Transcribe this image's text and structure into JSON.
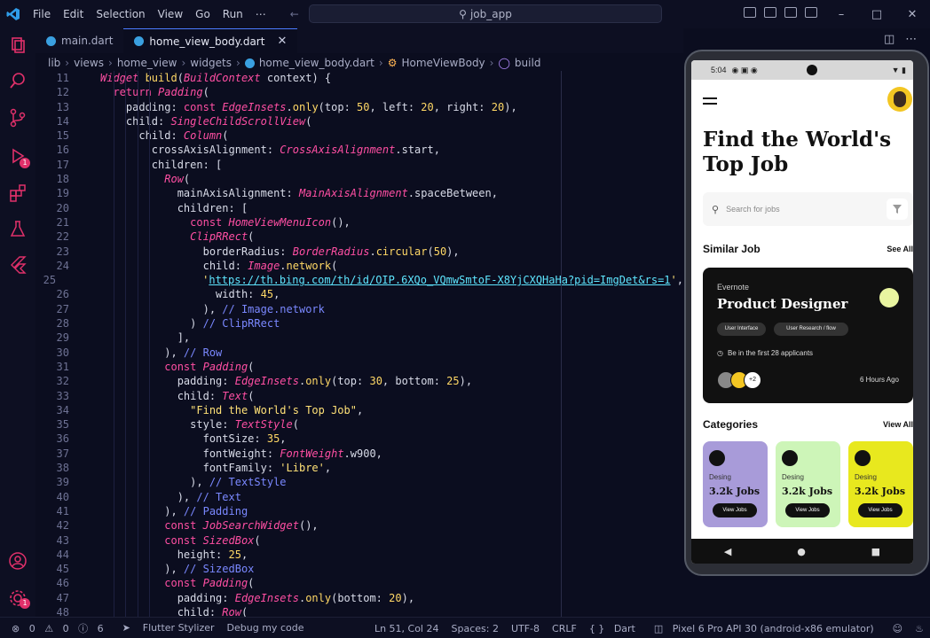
{
  "titlebar": {
    "menu": [
      "File",
      "Edit",
      "Selection",
      "View",
      "Go",
      "Run",
      "⋯"
    ],
    "search": "job_app"
  },
  "tabs": [
    {
      "label": "main.dart"
    },
    {
      "label": "home_view_body.dart"
    }
  ],
  "breadcrumb": [
    "lib",
    "views",
    "home_view",
    "widgets",
    "home_view_body.dart",
    "HomeViewBody",
    "build"
  ],
  "code_lines": [
    {
      "n": "11",
      "t": [
        [
          "ty",
          "Widget "
        ],
        [
          "fn",
          "build"
        ],
        [
          "pr",
          "("
        ],
        [
          "ty",
          "BuildContext"
        ],
        [
          "pr",
          " context) {"
        ]
      ]
    },
    {
      "n": "12",
      "t": [
        [
          "kw",
          "  return "
        ],
        [
          "ty",
          "Padding"
        ],
        [
          "pr",
          "("
        ]
      ]
    },
    {
      "n": "13",
      "t": [
        [
          "pr",
          "    padding: "
        ],
        [
          "kw",
          "const "
        ],
        [
          "ty",
          "EdgeInsets"
        ],
        [
          "pr",
          "."
        ],
        [
          "fn",
          "only"
        ],
        [
          "pr",
          "(top: "
        ],
        [
          "num",
          "50"
        ],
        [
          "pr",
          ", left: "
        ],
        [
          "num",
          "20"
        ],
        [
          "pr",
          ", right: "
        ],
        [
          "num",
          "20"
        ],
        [
          "pr",
          "),"
        ]
      ]
    },
    {
      "n": "14",
      "t": [
        [
          "pr",
          "    child: "
        ],
        [
          "ty",
          "SingleChildScrollView"
        ],
        [
          "pr",
          "("
        ]
      ]
    },
    {
      "n": "15",
      "t": [
        [
          "pr",
          "      child: "
        ],
        [
          "ty",
          "Column"
        ],
        [
          "pr",
          "("
        ]
      ]
    },
    {
      "n": "16",
      "t": [
        [
          "pr",
          "        crossAxisAlignment: "
        ],
        [
          "ty",
          "CrossAxisAlignment"
        ],
        [
          "pr",
          ".start,"
        ]
      ]
    },
    {
      "n": "17",
      "t": [
        [
          "pr",
          "        children: ["
        ]
      ]
    },
    {
      "n": "18",
      "t": [
        [
          "ty",
          "          Row"
        ],
        [
          "pr",
          "("
        ]
      ]
    },
    {
      "n": "19",
      "t": [
        [
          "pr",
          "            mainAxisAlignment: "
        ],
        [
          "ty",
          "MainAxisAlignment"
        ],
        [
          "pr",
          ".spaceBetween,"
        ]
      ]
    },
    {
      "n": "20",
      "t": [
        [
          "pr",
          "            children: ["
        ]
      ]
    },
    {
      "n": "21",
      "t": [
        [
          "kw",
          "              const "
        ],
        [
          "ty",
          "HomeViewMenuIcon"
        ],
        [
          "pr",
          "(),"
        ]
      ]
    },
    {
      "n": "22",
      "t": [
        [
          "ty",
          "              ClipRRect"
        ],
        [
          "pr",
          "("
        ]
      ]
    },
    {
      "n": "23",
      "t": [
        [
          "pr",
          "                borderRadius: "
        ],
        [
          "ty",
          "BorderRadius"
        ],
        [
          "pr",
          "."
        ],
        [
          "fn",
          "circular"
        ],
        [
          "pr",
          "("
        ],
        [
          "num",
          "50"
        ],
        [
          "pr",
          "),"
        ]
      ]
    },
    {
      "n": "24",
      "t": [
        [
          "pr",
          "                child: "
        ],
        [
          "ty",
          "Image"
        ],
        [
          "pr",
          "."
        ],
        [
          "fn",
          "network"
        ],
        [
          "pr",
          "("
        ]
      ]
    },
    {
      "n": "25",
      "t": [
        [
          "str",
          "                  '"
        ],
        [
          "link",
          "https://th.bing.com/th/id/OIP.6XQo_VQmwSmtoF-X8YjCXQHaHa?pid=ImgDet&rs=1"
        ],
        [
          "str",
          "'"
        ],
        [
          "pr",
          ","
        ]
      ]
    },
    {
      "n": "26",
      "t": [
        [
          "pr",
          "                  width: "
        ],
        [
          "num",
          "45"
        ],
        [
          "pr",
          ","
        ]
      ]
    },
    {
      "n": "27",
      "t": [
        [
          "pr",
          "                ), "
        ],
        [
          "cm",
          "// Image.network"
        ]
      ]
    },
    {
      "n": "28",
      "t": [
        [
          "pr",
          "              ) "
        ],
        [
          "cm",
          "// ClipRRect"
        ]
      ]
    },
    {
      "n": "29",
      "t": [
        [
          "pr",
          "            ],"
        ]
      ]
    },
    {
      "n": "30",
      "t": [
        [
          "pr",
          "          ), "
        ],
        [
          "cm",
          "// Row"
        ]
      ]
    },
    {
      "n": "31",
      "t": [
        [
          "kw",
          "          const "
        ],
        [
          "ty",
          "Padding"
        ],
        [
          "pr",
          "("
        ]
      ]
    },
    {
      "n": "32",
      "t": [
        [
          "pr",
          "            padding: "
        ],
        [
          "ty",
          "EdgeInsets"
        ],
        [
          "pr",
          "."
        ],
        [
          "fn",
          "only"
        ],
        [
          "pr",
          "(top: "
        ],
        [
          "num",
          "30"
        ],
        [
          "pr",
          ", bottom: "
        ],
        [
          "num",
          "25"
        ],
        [
          "pr",
          "),"
        ]
      ]
    },
    {
      "n": "33",
      "t": [
        [
          "pr",
          "            child: "
        ],
        [
          "ty",
          "Text"
        ],
        [
          "pr",
          "("
        ]
      ]
    },
    {
      "n": "34",
      "t": [
        [
          "str",
          "              \"Find the World's Top Job\""
        ],
        [
          "pr",
          ","
        ]
      ]
    },
    {
      "n": "35",
      "t": [
        [
          "pr",
          "              style: "
        ],
        [
          "ty",
          "TextStyle"
        ],
        [
          "pr",
          "("
        ]
      ]
    },
    {
      "n": "36",
      "t": [
        [
          "pr",
          "                fontSize: "
        ],
        [
          "num",
          "35"
        ],
        [
          "pr",
          ","
        ]
      ]
    },
    {
      "n": "37",
      "t": [
        [
          "pr",
          "                fontWeight: "
        ],
        [
          "ty",
          "FontWeight"
        ],
        [
          "pr",
          ".w900,"
        ]
      ]
    },
    {
      "n": "38",
      "t": [
        [
          "pr",
          "                fontFamily: "
        ],
        [
          "str",
          "'Libre'"
        ],
        [
          "pr",
          ","
        ]
      ]
    },
    {
      "n": "39",
      "t": [
        [
          "pr",
          "              ), "
        ],
        [
          "cm",
          "// TextStyle"
        ]
      ]
    },
    {
      "n": "40",
      "t": [
        [
          "pr",
          "            ), "
        ],
        [
          "cm",
          "// Text"
        ]
      ]
    },
    {
      "n": "41",
      "t": [
        [
          "pr",
          "          ), "
        ],
        [
          "cm",
          "// Padding"
        ]
      ]
    },
    {
      "n": "42",
      "t": [
        [
          "kw",
          "          const "
        ],
        [
          "ty",
          "JobSearchWidget"
        ],
        [
          "pr",
          "(),"
        ]
      ]
    },
    {
      "n": "43",
      "t": [
        [
          "kw",
          "          const "
        ],
        [
          "ty",
          "SizedBox"
        ],
        [
          "pr",
          "("
        ]
      ]
    },
    {
      "n": "44",
      "t": [
        [
          "pr",
          "            height: "
        ],
        [
          "num",
          "25"
        ],
        [
          "pr",
          ","
        ]
      ]
    },
    {
      "n": "45",
      "t": [
        [
          "pr",
          "          ), "
        ],
        [
          "cm",
          "// SizedBox"
        ]
      ]
    },
    {
      "n": "46",
      "t": [
        [
          "kw",
          "          const "
        ],
        [
          "ty",
          "Padding"
        ],
        [
          "pr",
          "("
        ]
      ]
    },
    {
      "n": "47",
      "t": [
        [
          "pr",
          "            padding: "
        ],
        [
          "ty",
          "EdgeInsets"
        ],
        [
          "pr",
          "."
        ],
        [
          "fn",
          "only"
        ],
        [
          "pr",
          "(bottom: "
        ],
        [
          "num",
          "20"
        ],
        [
          "pr",
          "),"
        ]
      ]
    },
    {
      "n": "48",
      "t": [
        [
          "pr",
          "            child: "
        ],
        [
          "ty",
          "Row"
        ],
        [
          "pr",
          "("
        ]
      ]
    }
  ],
  "phone": {
    "time": "5:04",
    "headline_1": "Find the World's",
    "headline_2": "Top Job",
    "search_placeholder": "Search for jobs",
    "similar_title": "Similar Job",
    "see_all": "See All",
    "job": {
      "company": "Evernote",
      "role": "Product Designer",
      "tag1": "User Interface",
      "tag2": "User Research / flow",
      "applicants": "Be in the first 28 applicants",
      "more": "+2",
      "posted": "6 Hours Ago"
    },
    "categories_title": "Categories",
    "view_all": "View All",
    "categories": [
      {
        "label": "Desing",
        "count": "3.2k Jobs",
        "button": "View Jobs",
        "color": "#a89bd9"
      },
      {
        "label": "Desing",
        "count": "3.2k Jobs",
        "button": "View Jobs",
        "color": "#cdf5b8"
      },
      {
        "label": "Desing",
        "count": "3.2k Jobs",
        "button": "View Jobs",
        "color": "#e8e81e"
      }
    ]
  },
  "statusbar": {
    "errors": "0",
    "warnings": "0",
    "infos": "6",
    "stylizer": "Flutter Stylizer",
    "debug": "Debug my code",
    "position": "Ln 51, Col 24",
    "spaces": "Spaces: 2",
    "encoding": "UTF-8",
    "eol": "CRLF",
    "language": "Dart",
    "device": "Pixel 6 Pro API 30 (android-x86 emulator)"
  },
  "colors": {
    "accent": "#3aa0e0",
    "badge": "#e0306a",
    "keyword": "#ff4fa3",
    "function": "#ffd866"
  }
}
